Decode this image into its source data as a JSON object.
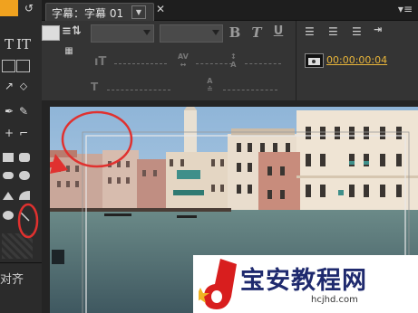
{
  "titlebar": {
    "tab_title": "字幕：字幕 01",
    "tab_menu_glyph": "▼",
    "close_glyph": "✕",
    "panel_menu_glyph": "▾≡"
  },
  "tools": {
    "align_label": "对齐",
    "icons": [
      "text-tool-icon",
      "vertical-text-tool-icon",
      "area-text-tool-icon",
      "vertical-area-text-icon",
      "path-text-icon",
      "vertical-path-text-icon",
      "pen-tool-icon",
      "delete-anchor-icon",
      "add-anchor-icon",
      "convert-anchor-icon",
      "rectangle-tool-icon",
      "rounded-rect-tool-icon",
      "ellipse-tool-icon",
      "line-tool-icon"
    ]
  },
  "toolbar": {
    "bold_label": "B",
    "italic_label": "T",
    "underline_label": "U",
    "timecode": "00:00:00:04"
  },
  "annotation": {
    "circle_color": "#e0312f"
  },
  "watermark": {
    "site_name": "宝安教程网",
    "url": "hcjhd.com",
    "logo_color": "#d81e1e"
  }
}
